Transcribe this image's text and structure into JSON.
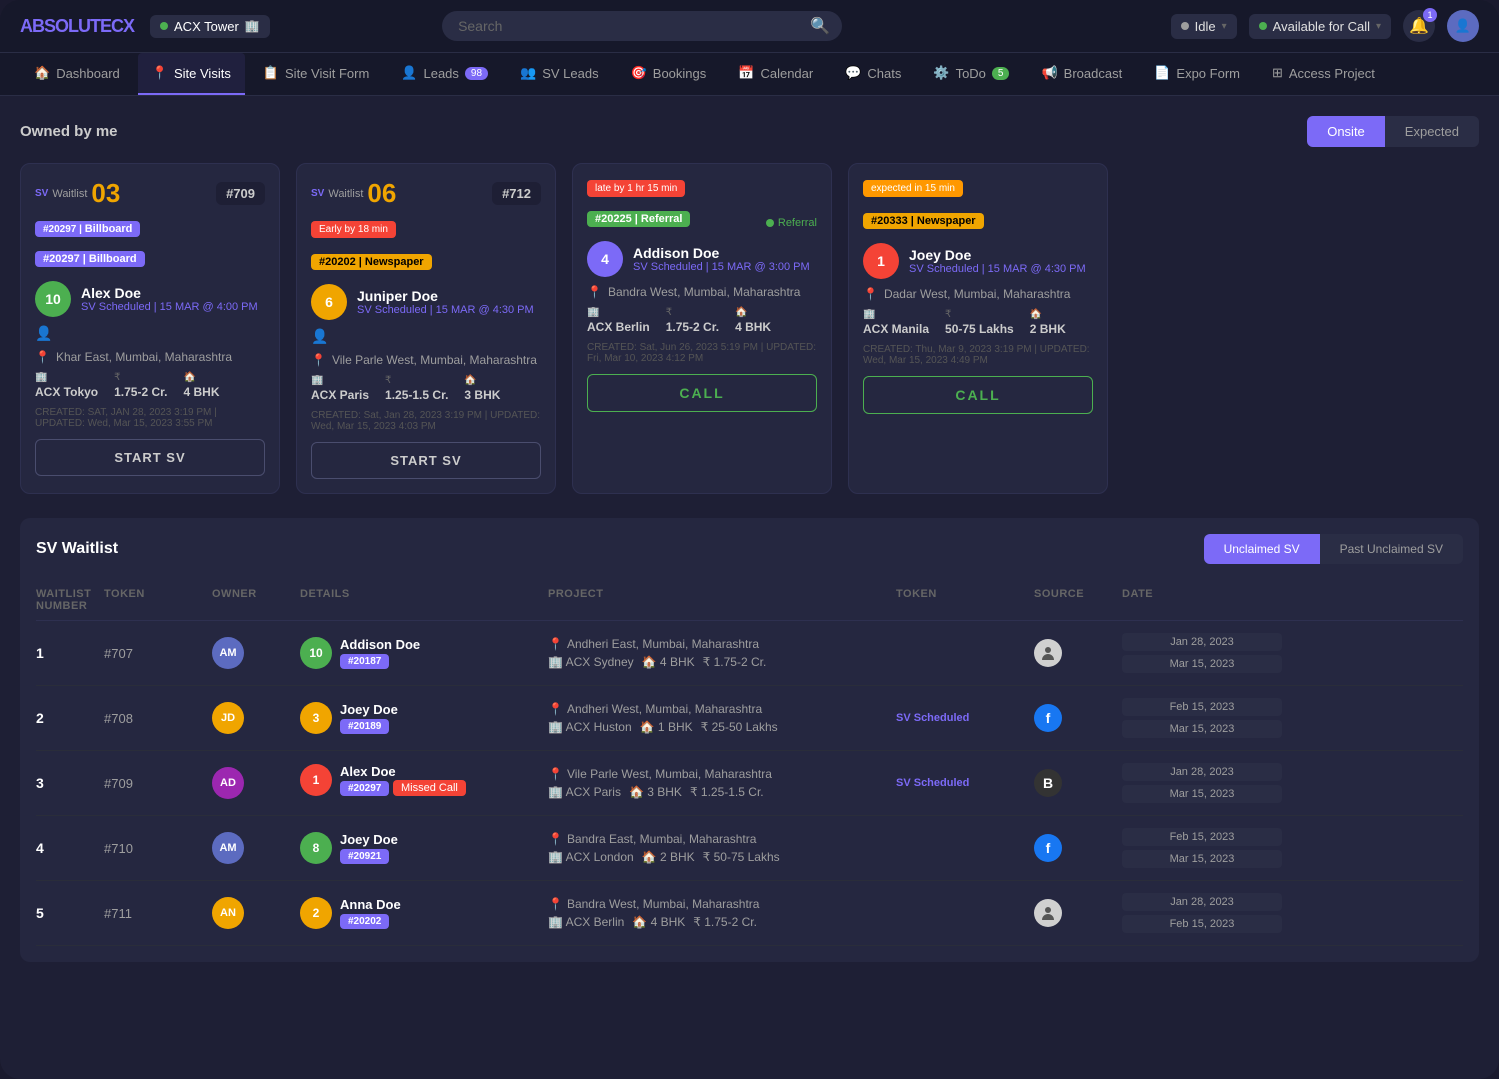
{
  "app": {
    "logo": "ABSOLUTE",
    "logo_accent": "CX",
    "project": "ACX Tower",
    "project_status": "active"
  },
  "topbar": {
    "search_placeholder": "Search",
    "status": "Idle",
    "call_status": "Available for Call",
    "notif_count": "1"
  },
  "nav": {
    "tabs": [
      {
        "label": "Dashboard",
        "icon": "home-icon",
        "active": false
      },
      {
        "label": "Site Visits",
        "icon": "map-icon",
        "active": true
      },
      {
        "label": "Site Visit Form",
        "icon": "file-icon",
        "active": false
      },
      {
        "label": "Leads",
        "icon": "person-icon",
        "active": false,
        "badge": "98",
        "badge_color": "purple"
      },
      {
        "label": "SV Leads",
        "icon": "people-icon",
        "active": false
      },
      {
        "label": "Bookings",
        "icon": "target-icon",
        "active": false
      },
      {
        "label": "Calendar",
        "icon": "calendar-icon",
        "active": false
      },
      {
        "label": "Chats",
        "icon": "chat-icon",
        "active": false
      },
      {
        "label": "ToDo",
        "icon": "gear-icon",
        "active": false,
        "badge": "5",
        "badge_color": "green"
      },
      {
        "label": "Broadcast",
        "icon": "bell-icon",
        "active": false
      },
      {
        "label": "Expo Form",
        "icon": "doc-icon",
        "active": false
      },
      {
        "label": "Access Project",
        "icon": "grid-icon",
        "active": false
      }
    ]
  },
  "owned_by_me": {
    "title": "Owned by me",
    "toggle": {
      "onsite": "Onsite",
      "expected": "Expected",
      "active": "onsite"
    },
    "cards": [
      {
        "waitlist_prefix": "SV Waitlist",
        "waitlist_num": "03",
        "token": "#709",
        "source": "Billboard",
        "source_class": "billboard",
        "person_name": "Alex Doe",
        "person_color": "#4caf50",
        "person_initials": "10",
        "schedule": "SV Scheduled | 15 MAR @ 4:00 PM",
        "location": "Khar East, Mumbai, Maharashtra",
        "project": "ACX Tokyo",
        "price": "1.75-2 Cr.",
        "bhk": "4 BHK",
        "created": "CREATED: SAT, JAN 28, 2023 3:19 PM | UPDATED: Wed, Mar 15, 2023 3:55 PM",
        "action": "START SV",
        "has_missed_call": false,
        "alert": null
      },
      {
        "waitlist_prefix": "SV Waitlist",
        "waitlist_num": "06",
        "token": "#712",
        "source": "Newspaper",
        "source_class": "newspaper",
        "person_name": "Juniper Doe",
        "person_color": "#f0a500",
        "person_initials": "6",
        "schedule": "SV Scheduled | 15 MAR @ 4:30 PM",
        "location": "Vile Parle West, Mumbai, Maharashtra",
        "project": "ACX Paris",
        "price": "1.25-1.5 Cr.",
        "bhk": "3 BHK",
        "created": "CREATED: Sat, Jan 28, 2023 3:19 PM | UPDATED: Wed, Mar 15, 2023 4:03 PM",
        "action": "START SV",
        "has_missed_call": false,
        "alert": "Early by 18 min"
      },
      {
        "waitlist_prefix": null,
        "waitlist_num": null,
        "token": null,
        "source": "Referral",
        "source_class": "referral",
        "lead_id": "#20225",
        "person_name": "Addison Doe",
        "person_color": "#7c6af7",
        "person_initials": "4",
        "schedule": "SV Scheduled | 15 MAR @ 3:00 PM",
        "location": "Bandra West, Mumbai, Maharashtra",
        "project": "ACX Berlin",
        "price": "1.75-2 Cr.",
        "bhk": "4 BHK",
        "created": "CREATED: Sat, Jun 26, 2023 5:19 PM | UPDATED: Fri, Mar 10, 2023 4:12 PM",
        "action": "CALL",
        "has_missed_call": false,
        "alert": "late by 1 hr 15 min",
        "alert_class": "late"
      },
      {
        "waitlist_prefix": null,
        "waitlist_num": null,
        "token": null,
        "source": "Newspaper",
        "source_class": "newspaper",
        "lead_id": "#20333",
        "person_name": "Joey Doe",
        "person_color": "#f44336",
        "person_initials": "1",
        "schedule": "SV Scheduled | 15 MAR @ 4:30 PM",
        "location": "Dadar West, Mumbai, Maharashtra",
        "project": "ACX Manila",
        "price": "50-75 Lakhs",
        "bhk": "2 BHK",
        "created": "CREATED: Thu, Mar 9, 2023 3:19 PM | UPDATED: Wed, Mar 15, 2023 4:49 PM",
        "action": "CALL",
        "has_missed_call": false,
        "alert": "expected in 15 min",
        "alert_class": "expected"
      }
    ]
  },
  "sv_waitlist": {
    "title": "SV Waitlist",
    "tabs": {
      "unclaimed": "Unclaimed SV",
      "past": "Past Unclaimed SV",
      "active": "unclaimed"
    },
    "columns": [
      "WAITLIST NUMBER",
      "TOKEN",
      "OWNER",
      "DETAILS",
      "PROJECT",
      "TOKEN",
      "SOURCE",
      "DATE"
    ],
    "rows": [
      {
        "num": "1",
        "token": "#707",
        "owner_initials": "AM",
        "owner_color": "#5c6bc0",
        "person_name": "Addison Doe",
        "person_id": "#20187",
        "person_color": "#4caf50",
        "person_initials": "10",
        "has_missed_call": false,
        "location": "Andheri East, Mumbai, Maharashtra",
        "project": "ACX Sydney",
        "bhk": "4 BHK",
        "price": "1.75-2 Cr.",
        "sv_status": null,
        "source_type": "img",
        "source_color": "#e0e0e0",
        "date1": "Jan 28, 2023",
        "date2": "Mar 15, 2023"
      },
      {
        "num": "2",
        "token": "#708",
        "owner_initials": "JD",
        "owner_color": "#f0a500",
        "person_name": "Joey Doe",
        "person_id": "#20189",
        "person_color": "#f0a500",
        "person_initials": "3",
        "has_missed_call": false,
        "location": "Andheri West, Mumbai, Maharashtra",
        "project": "ACX Huston",
        "bhk": "1 BHK",
        "price": "25-50 Lakhs",
        "sv_status": "SV Scheduled",
        "source_type": "fb",
        "source_color": "#1877f2",
        "date1": "Feb 15, 2023",
        "date2": "Mar 15, 2023"
      },
      {
        "num": "3",
        "token": "#709",
        "owner_initials": "AD",
        "owner_color": "#9c27b0",
        "person_name": "Alex Doe",
        "person_id": "#20297",
        "person_color": "#f44336",
        "person_initials": "1",
        "has_missed_call": true,
        "location": "Vile Parle West, Mumbai, Maharashtra",
        "project": "ACX Paris",
        "bhk": "3 BHK",
        "price": "1.25-1.5 Cr.",
        "sv_status": "SV Scheduled",
        "source_type": "b",
        "source_color": "#333",
        "date1": "Jan 28, 2023",
        "date2": "Mar 15, 2023"
      },
      {
        "num": "4",
        "token": "#710",
        "owner_initials": "AM",
        "owner_color": "#5c6bc0",
        "person_name": "Joey Doe",
        "person_id": "#20921",
        "person_color": "#4caf50",
        "person_initials": "8",
        "has_missed_call": false,
        "location": "Bandra East, Mumbai, Maharashtra",
        "project": "ACX London",
        "bhk": "2 BHK",
        "price": "50-75 Lakhs",
        "sv_status": null,
        "source_type": "fb",
        "source_color": "#1877f2",
        "date1": "Feb 15, 2023",
        "date2": "Mar 15, 2023"
      },
      {
        "num": "5",
        "token": "#711",
        "owner_initials": "AN",
        "owner_color": "#f0a500",
        "person_name": "Anna Doe",
        "person_id": "#20202",
        "person_color": "#f0a500",
        "person_initials": "2",
        "has_missed_call": false,
        "location": "Bandra West, Mumbai, Maharashtra",
        "project": "ACX Berlin",
        "bhk": "4 BHK",
        "price": "1.75-2 Cr.",
        "sv_status": null,
        "source_type": "img",
        "source_color": "#e0e0e0",
        "date1": "Jan 28, 2023",
        "date2": "Feb 15, 2023"
      }
    ]
  }
}
